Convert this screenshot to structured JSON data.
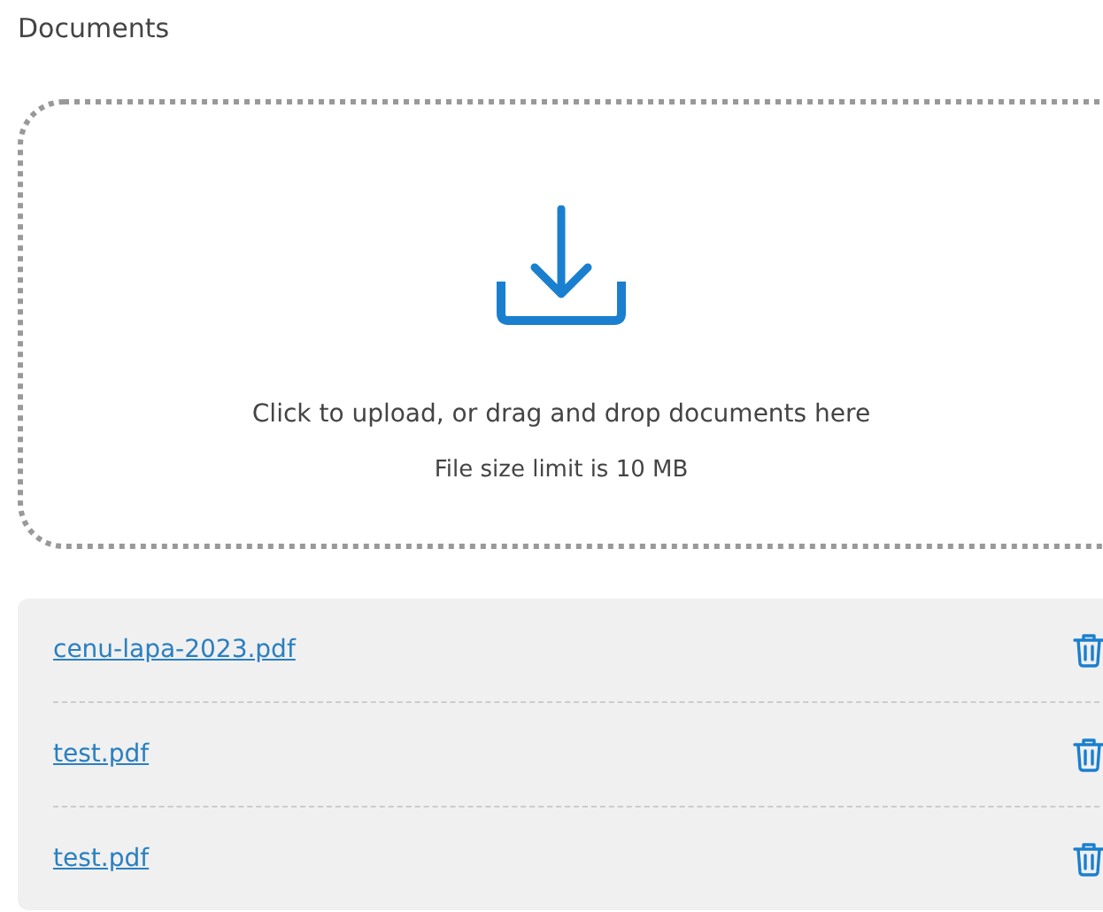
{
  "title": "Documents",
  "dropzone": {
    "instruction": "Click to upload, or drag and drop documents here",
    "limit": "File size limit is 10 MB"
  },
  "files": [
    {
      "name": "cenu-lapa-2023.pdf"
    },
    {
      "name": "test.pdf"
    },
    {
      "name": "test.pdf"
    }
  ]
}
